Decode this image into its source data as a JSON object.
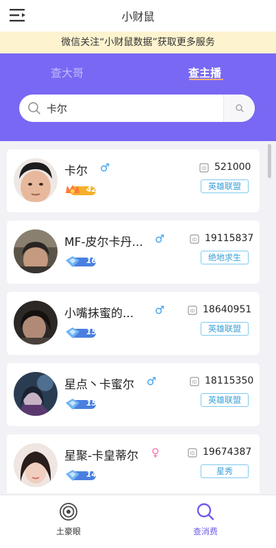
{
  "app": {
    "title": "小财鼠"
  },
  "notice": "微信关注“小财鼠数据”获取更多服务",
  "tabs": [
    {
      "label": "查大哥",
      "active": false
    },
    {
      "label": "查主播",
      "active": true
    }
  ],
  "search": {
    "value": "卡尔"
  },
  "results": [
    {
      "name": "卡尔",
      "gender": "♂",
      "level": "42",
      "id": "521000",
      "category": "英雄联盟"
    },
    {
      "name": "MF-皮尔卡丹...",
      "gender": "♂",
      "level": "16",
      "id": "19115837",
      "category": "绝地求生"
    },
    {
      "name": "小嘴抹蜜的...",
      "gender": "♂",
      "level": "15",
      "id": "18640951",
      "category": "英雄联盟"
    },
    {
      "name": "星点丶卡蜜尔",
      "gender": "♂",
      "level": "15",
      "id": "18115350",
      "category": "英雄联盟"
    },
    {
      "name": "星聚-卡皇蒂尔",
      "gender": "♀",
      "level": "14",
      "id": "19674387",
      "category": "星秀"
    }
  ],
  "bottom_nav": [
    {
      "label": "土豪眼",
      "active": false
    },
    {
      "label": "查消费",
      "active": true
    }
  ],
  "colors": {
    "header_purple": "#7868f3",
    "notice_bg": "#fdf3cf",
    "male_blue": "#3aa0f0",
    "female_pink": "#ff6fae",
    "badge_blue": "#3a9fd6",
    "nav_active": "#6e5ce8",
    "tab_underline": "#ffb070"
  },
  "icons": [
    "menu-icon",
    "search-icon",
    "id-card-icon",
    "level-badge-icon",
    "radar-icon"
  ]
}
